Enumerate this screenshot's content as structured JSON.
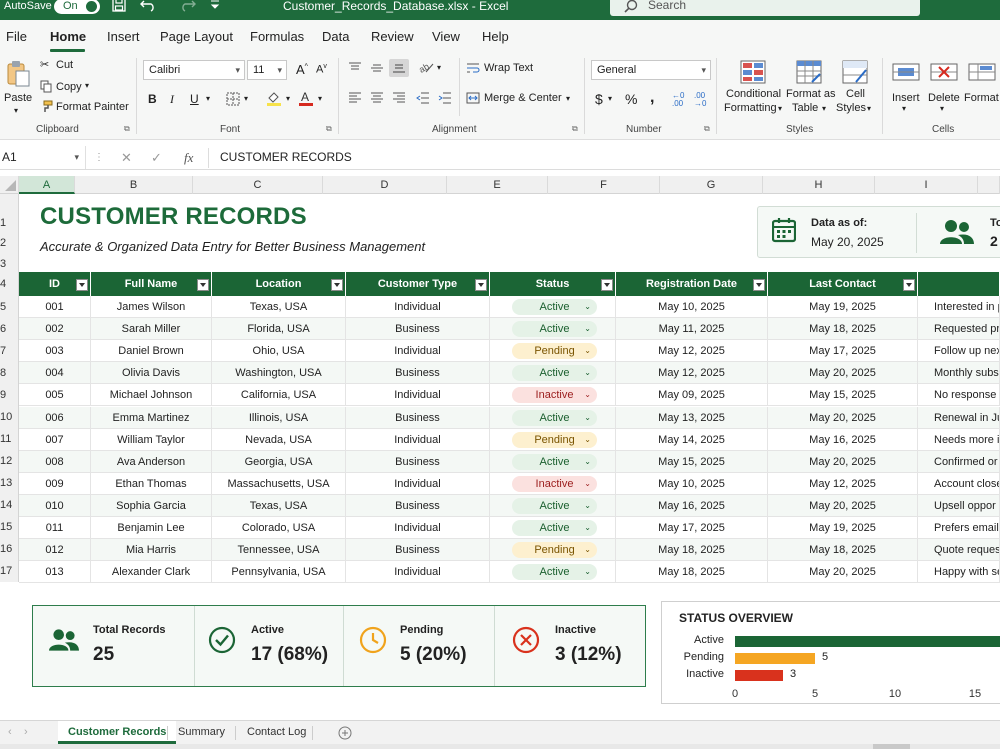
{
  "titlebar": {
    "autosave_label": "AutoSave",
    "autosave_state": "On",
    "filename": "Customer_Records_Database.xlsx - Excel",
    "search_placeholder": "Search"
  },
  "menu": {
    "tabs": [
      "File",
      "Home",
      "Insert",
      "Page Layout",
      "Formulas",
      "Data",
      "Review",
      "View",
      "Help"
    ],
    "active": "Home"
  },
  "ribbon": {
    "clipboard": {
      "paste": "Paste",
      "cut": "Cut",
      "copy": "Copy",
      "format_painter": "Format Painter",
      "label": "Clipboard"
    },
    "font": {
      "name": "Calibri",
      "size": "11",
      "label": "Font"
    },
    "alignment": {
      "wrap_text": "Wrap Text",
      "merge_center": "Merge & Center",
      "label": "Alignment"
    },
    "number": {
      "format": "General",
      "label": "Number"
    },
    "styles": {
      "conditional": [
        "Conditional",
        "Formatting"
      ],
      "format_table": [
        "Format as",
        "Table"
      ],
      "cell_styles": [
        "Cell",
        "Styles"
      ],
      "label": "Styles"
    },
    "cells": {
      "insert": "Insert",
      "delete": "Delete",
      "format": "Format",
      "label": "Cells"
    }
  },
  "formula_bar": {
    "name_box": "A1",
    "fx": "fx",
    "content": "CUSTOMER RECORDS"
  },
  "columns": [
    "A",
    "B",
    "C",
    "D",
    "E",
    "F",
    "G",
    "H",
    "I"
  ],
  "selected_column": "A",
  "rows": [
    "1",
    "2",
    "3",
    "4",
    "5",
    "6",
    "7",
    "8",
    "9",
    "10",
    "11",
    "12",
    "13",
    "14",
    "15",
    "16",
    "17"
  ],
  "sheet": {
    "title": "CUSTOMER RECORDS",
    "subtitle": "Accurate & Organized Data Entry for Better Business Management",
    "data_as_of_label": "Data as of:",
    "data_as_of_value": "May 20, 2025",
    "second_card_label": "To",
    "second_card_value": "2"
  },
  "table": {
    "headers": [
      "ID",
      "Full Name",
      "Location",
      "Customer Type",
      "Status",
      "Registration Date",
      "Last Contact",
      ""
    ],
    "records": [
      {
        "id": "001",
        "name": "James Wilson",
        "location": "Texas, USA",
        "type": "Individual",
        "status": "Active",
        "reg": "May 10, 2025",
        "last": "May 19, 2025",
        "notes": "Interested in p"
      },
      {
        "id": "002",
        "name": "Sarah Miller",
        "location": "Florida, USA",
        "type": "Business",
        "status": "Active",
        "reg": "May 11, 2025",
        "last": "May 18, 2025",
        "notes": "Requested pr"
      },
      {
        "id": "003",
        "name": "Daniel Brown",
        "location": "Ohio, USA",
        "type": "Individual",
        "status": "Pending",
        "reg": "May 12, 2025",
        "last": "May 17, 2025",
        "notes": "Follow up nex"
      },
      {
        "id": "004",
        "name": "Olivia Davis",
        "location": "Washington, USA",
        "type": "Business",
        "status": "Active",
        "reg": "May 12, 2025",
        "last": "May 20, 2025",
        "notes": "Monthly subs"
      },
      {
        "id": "005",
        "name": "Michael Johnson",
        "location": "California, USA",
        "type": "Individual",
        "status": "Inactive",
        "reg": "May 09, 2025",
        "last": "May 15, 2025",
        "notes": "No response t"
      },
      {
        "id": "006",
        "name": "Emma Martinez",
        "location": "Illinois, USA",
        "type": "Business",
        "status": "Active",
        "reg": "May 13, 2025",
        "last": "May 20, 2025",
        "notes": "Renewal in Ju"
      },
      {
        "id": "007",
        "name": "William Taylor",
        "location": "Nevada, USA",
        "type": "Individual",
        "status": "Pending",
        "reg": "May 14, 2025",
        "last": "May 16, 2025",
        "notes": "Needs more in"
      },
      {
        "id": "008",
        "name": "Ava Anderson",
        "location": "Georgia, USA",
        "type": "Business",
        "status": "Active",
        "reg": "May 15, 2025",
        "last": "May 20, 2025",
        "notes": "Confirmed or"
      },
      {
        "id": "009",
        "name": "Ethan Thomas",
        "location": "Massachusetts, USA",
        "type": "Individual",
        "status": "Inactive",
        "reg": "May 10, 2025",
        "last": "May 12, 2025",
        "notes": "Account close"
      },
      {
        "id": "010",
        "name": "Sophia Garcia",
        "location": "Texas, USA",
        "type": "Business",
        "status": "Active",
        "reg": "May 16, 2025",
        "last": "May 20, 2025",
        "notes": "Upsell oppor"
      },
      {
        "id": "011",
        "name": "Benjamin Lee",
        "location": "Colorado, USA",
        "type": "Individual",
        "status": "Active",
        "reg": "May 17, 2025",
        "last": "May 19, 2025",
        "notes": "Prefers email"
      },
      {
        "id": "012",
        "name": "Mia Harris",
        "location": "Tennessee, USA",
        "type": "Business",
        "status": "Pending",
        "reg": "May 18, 2025",
        "last": "May 18, 2025",
        "notes": "Quote reques"
      },
      {
        "id": "013",
        "name": "Alexander Clark",
        "location": "Pennsylvania, USA",
        "type": "Individual",
        "status": "Active",
        "reg": "May 18, 2025",
        "last": "May 20, 2025",
        "notes": "Happy with se"
      }
    ]
  },
  "summary": {
    "total_label": "Total Records",
    "total_value": "25",
    "active_label": "Active",
    "active_value": "17 (68%)",
    "pending_label": "Pending",
    "pending_value": "5 (20%)",
    "inactive_label": "Inactive",
    "inactive_value": "3 (12%)"
  },
  "chart_data": {
    "type": "bar",
    "orientation": "horizontal",
    "title": "STATUS OVERVIEW",
    "categories": [
      "Active",
      "Pending",
      "Inactive"
    ],
    "values": [
      17,
      5,
      3
    ],
    "data_labels": [
      "",
      "5",
      "3"
    ],
    "colors": [
      "#1b6535",
      "#f5a623",
      "#d9321d"
    ],
    "xticks": [
      "0",
      "5",
      "10",
      "15"
    ],
    "xlim": [
      0,
      17
    ]
  },
  "sheet_tabs": {
    "tabs": [
      "Customer Records",
      "Summary",
      "Contact Log"
    ],
    "active": "Customer Records"
  },
  "colors": {
    "brand_green": "#1e6b3c",
    "active_bg": "#e5f2e7",
    "pending_bg": "#fdf0cf",
    "inactive_bg": "#fbe1df"
  }
}
